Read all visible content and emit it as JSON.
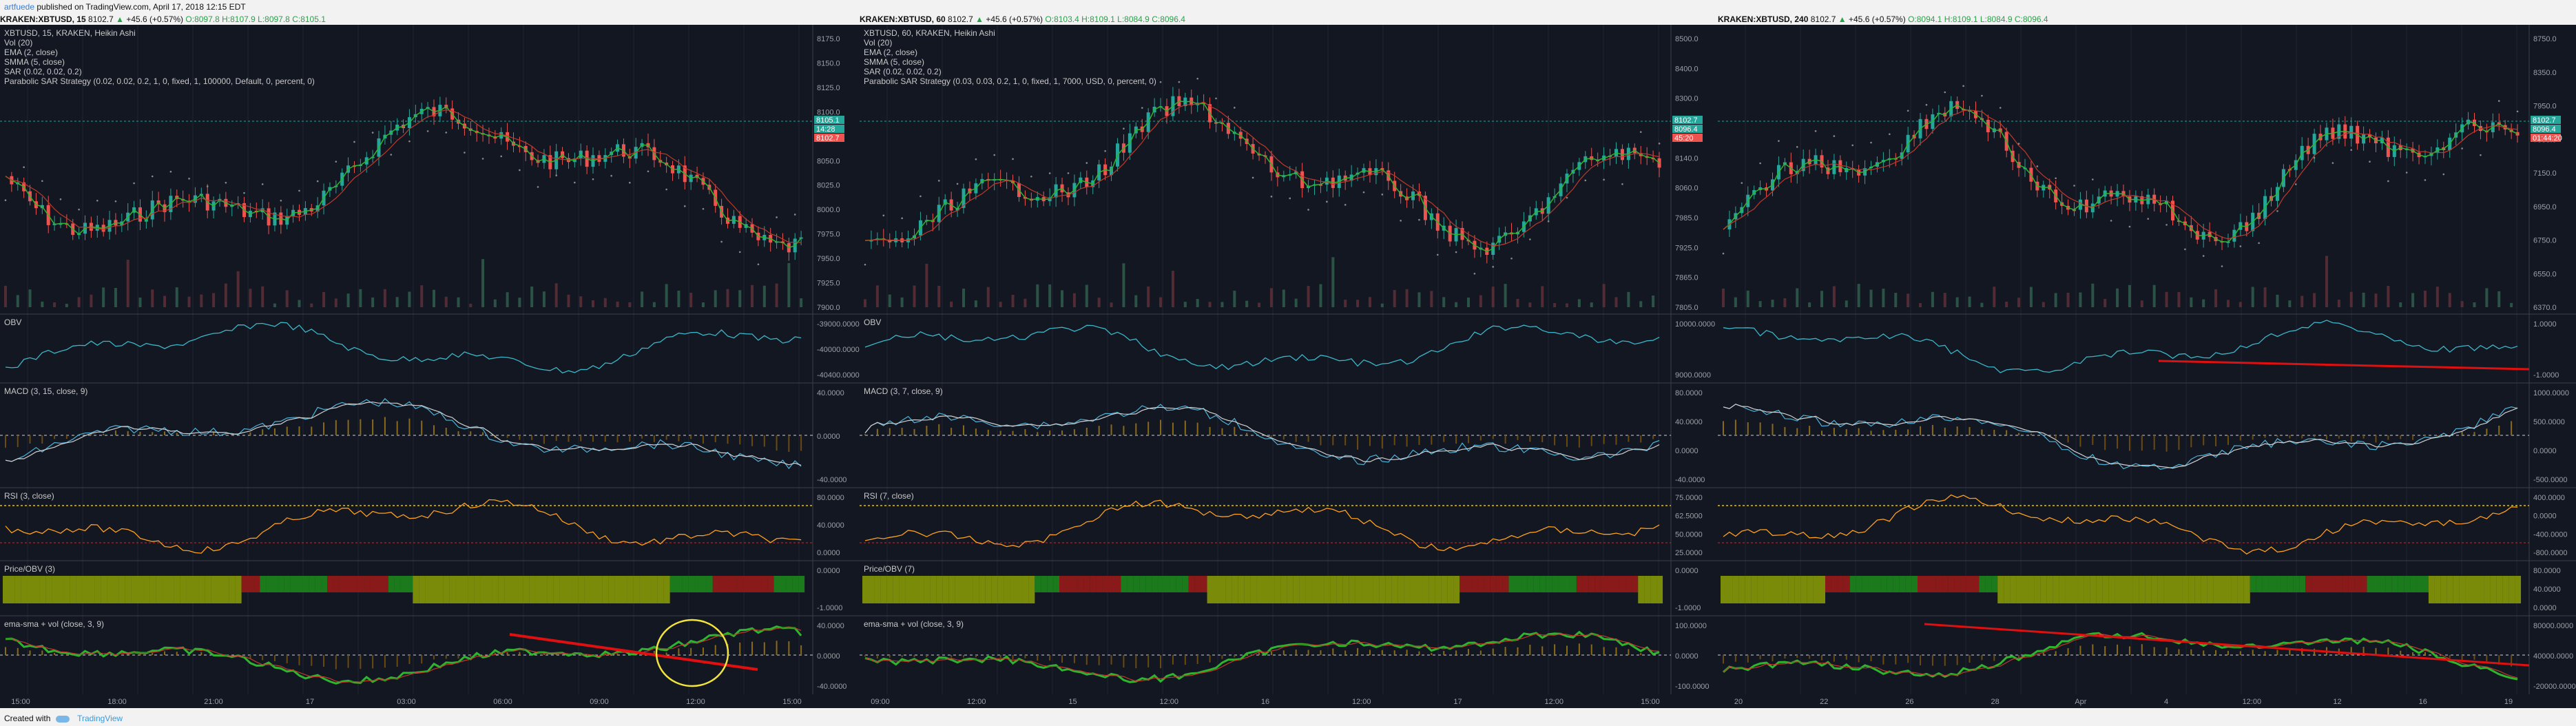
{
  "header": {
    "author": "artfuede",
    "published": " published on TradingView.com, April 17, 2018 12:15 EDT"
  },
  "footer": {
    "created_with": "Created with",
    "brand": "TradingView"
  },
  "charts": [
    {
      "symbol": "KRAKEN:XBTUSD",
      "interval": "15",
      "last": "8102.7",
      "change": "+45.6 (+0.57%)",
      "ohlc": "O:8097.8 H:8107.9 L:8097.8 C:8105.1",
      "legend": [
        "XBTUSD, 15, KRAKEN, Heikin Ashi",
        "Vol (20)",
        "EMA (2, close)",
        "SMMA (5, close)",
        "SAR (0.02, 0.02, 0.2)",
        "Parabolic SAR Strategy (0.02, 0.02, 0.2, 1, 0, fixed, 1, 100000, Default, 0, percent, 0)"
      ],
      "price_axis": [
        "8175.0",
        "8150.0",
        "8125.0",
        "8100.0",
        "8075.0",
        "8050.0",
        "8025.0",
        "8000.0",
        "7975.0",
        "7950.0",
        "7925.0",
        "7900.0"
      ],
      "price_tags": [
        "8105.1",
        "14:28",
        "8102.7"
      ],
      "time_axis": [
        "15:00",
        "18:00",
        "21:00",
        "17",
        "03:00",
        "06:00",
        "09:00",
        "12:00",
        "15:00"
      ],
      "panes": [
        {
          "title": "OBV",
          "axis": [
            "-39000.0000",
            "-40000.0000",
            "-40400.0000"
          ]
        },
        {
          "title": "MACD (3, 15, close, 9)",
          "axis": [
            "40.0000",
            "0.0000",
            "-40.0000"
          ]
        },
        {
          "title": "RSI (3, close)",
          "axis": [
            "80.0000",
            "40.0000",
            "0.0000"
          ]
        },
        {
          "title": "Price/OBV (3)",
          "axis": [
            "0.0000",
            "-1.0000"
          ]
        },
        {
          "title": "ema-sma + vol (close, 3, 9)",
          "axis": [
            "40.0000",
            "0.0000",
            "-40.0000"
          ]
        }
      ]
    },
    {
      "symbol": "KRAKEN:XBTUSD",
      "interval": "60",
      "last": "8102.7",
      "change": "+45.6 (+0.57%)",
      "ohlc": "O:8103.4 H:8109.1 L:8084.9 C:8096.4",
      "legend": [
        "XBTUSD, 60, KRAKEN, Heikin Ashi",
        "Vol (20)",
        "EMA (2, close)",
        "SMMA (5, close)",
        "SAR (0.02, 0.02, 0.2)",
        "Parabolic SAR Strategy (0.03, 0.03, 0.2, 1, 0, fixed, 1, 7000, USD, 0, percent, 0)"
      ],
      "price_axis": [
        "8500.0",
        "8400.0",
        "8300.0",
        "8220.0",
        "8140.0",
        "8060.0",
        "7985.0",
        "7925.0",
        "7865.0",
        "7805.0"
      ],
      "price_tags": [
        "8102.7",
        "8096.4",
        "45:20"
      ],
      "time_axis": [
        "09:00",
        "12:00",
        "15",
        "12:00",
        "16",
        "12:00",
        "17",
        "12:00",
        "15:00"
      ],
      "panes": [
        {
          "title": "OBV",
          "axis": [
            "10000.0000",
            "9000.0000"
          ]
        },
        {
          "title": "MACD (3, 7, close, 9)",
          "axis": [
            "80.0000",
            "40.0000",
            "0.0000",
            "-40.0000"
          ]
        },
        {
          "title": "RSI (7, close)",
          "axis": [
            "75.0000",
            "62.5000",
            "50.0000",
            "25.0000"
          ]
        },
        {
          "title": "Price/OBV (7)",
          "axis": [
            "0.0000",
            "-1.0000"
          ]
        },
        {
          "title": "ema-sma + vol (close, 3, 9)",
          "axis": [
            "100.0000",
            "0.0000",
            "-100.0000"
          ]
        }
      ]
    },
    {
      "symbol": "KRAKEN:XBTUSD",
      "interval": "240",
      "last": "8102.7",
      "change": "+45.6 (+0.57%)",
      "ohlc": "O:8094.1 H:8109.1 L:8084.9 C:8096.4",
      "legend": [],
      "price_axis": [
        "8750.0",
        "8350.0",
        "7950.0",
        "7550.0",
        "7150.0",
        "6950.0",
        "6750.0",
        "6550.0",
        "6370.0"
      ],
      "price_tags": [
        "8102.7",
        "8096.4",
        "01:44:20"
      ],
      "time_axis": [
        "20",
        "22",
        "26",
        "28",
        "Apr",
        "4",
        "12:00",
        "12",
        "16",
        "19"
      ],
      "panes": [
        {
          "title": "",
          "axis": [
            "1.0000",
            "-1.0000"
          ]
        },
        {
          "title": "",
          "axis": [
            "1000.0000",
            "500.0000",
            "0.0000",
            "-500.0000"
          ]
        },
        {
          "title": "",
          "axis": [
            "400.0000",
            "0.0000",
            "-400.0000",
            "-800.0000"
          ]
        },
        {
          "title": "",
          "axis": [
            "80.0000",
            "40.0000",
            "0.0000"
          ]
        },
        {
          "title": "",
          "axis": [
            "80000.0000",
            "40000.0000",
            "-20000.0000"
          ]
        }
      ]
    }
  ],
  "colors": {
    "background": "#131722",
    "bull": "#26a69a",
    "bear": "#ef5350",
    "ema": "#2db52d",
    "smma": "#c0392b",
    "sar": "#8a8a8a",
    "obv": "#3ab7c9",
    "rsi": "#ff9f1c",
    "price_obv": "#7a8b0a",
    "trend_line": "#e01010",
    "circle": "#f2e33d"
  }
}
